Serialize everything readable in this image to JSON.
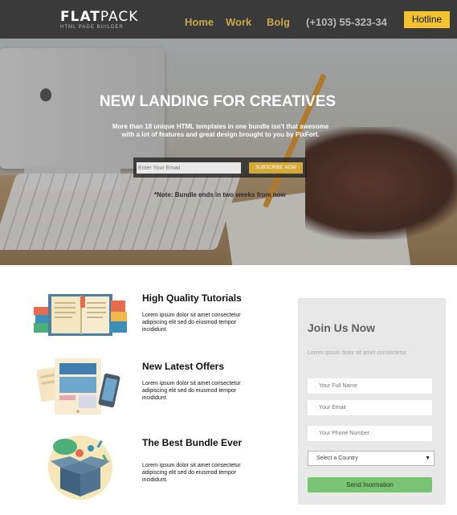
{
  "header": {
    "logo_main_bold": "FLAT",
    "logo_main_light": "PACK",
    "logo_sub": "HTML PAGE BUILDER",
    "nav": [
      "Home",
      "Work",
      "Bolg"
    ],
    "phone": "(+103) 55-323-34",
    "hotline": "Hotline"
  },
  "hero": {
    "title": "NEW LANDING FOR CREATIVES",
    "description": "More than 18 unique HTML templates in one bundle isn't that awesome with a lot of features and great design brought to you by PixFort.",
    "email_placeholder": "Enter Your Email",
    "subscribe_label": "SUBSCRIBE NOW",
    "note": "*Note: Bundle ends in two weeks from now"
  },
  "features": [
    {
      "title": "High Quality Tutorials",
      "text": "Lorem ipsum dolor sit amet consectetur adipiscing elit sed do eiusmod tempor incididunt.",
      "icon": "books-icon"
    },
    {
      "title": "New Latest Offers",
      "text": "Lorem ipsum dolor sit amet consectetur adipiscing elit sed do eiusmod tempor incididunt.",
      "icon": "devices-icon"
    },
    {
      "title": "The Best Bundle Ever",
      "text": "Lorem ipsum dolor sit amet consectetur adipiscing elit sed do eiusmod tempor incididunt.",
      "icon": "gift-box-icon"
    }
  ],
  "join": {
    "title": "Join Us Now",
    "text": "Lorem ipsum dolor sit amet consectetur.",
    "name_placeholder": "Your Full Name",
    "email_placeholder": "Your Email",
    "phone_placeholder": "Your Phone Number",
    "country_selected": "Select a Country",
    "send_label": "Send İnormation"
  },
  "colors": {
    "header_bg": "#3a3a3a",
    "nav_text": "#c8a84b",
    "hotline_bg": "#f4c430",
    "subscribe_bg": "#d4a93a",
    "panel_bg": "#e8e8e8",
    "send_bg": "#78c472"
  }
}
